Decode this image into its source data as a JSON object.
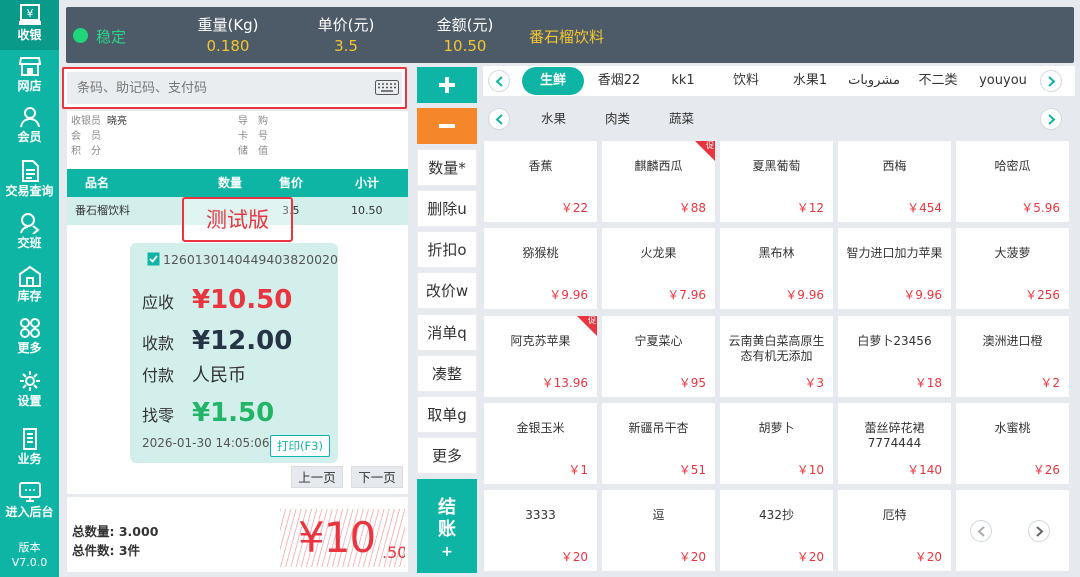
{
  "nav": {
    "items": [
      {
        "label": "收银",
        "icon": "yen-register-icon"
      },
      {
        "label": "网店",
        "icon": "store-icon"
      },
      {
        "label": "会员",
        "icon": "member-icon"
      },
      {
        "label": "交易查询",
        "icon": "transaction-doc-icon"
      },
      {
        "label": "交班",
        "icon": "shift-handover-icon"
      },
      {
        "label": "库存",
        "icon": "warehouse-icon"
      },
      {
        "label": "更多",
        "icon": "more-grid-icon"
      },
      {
        "label": "设置",
        "icon": "gear-icon"
      },
      {
        "label": "业务",
        "icon": "business-icon"
      },
      {
        "label": "进入后台",
        "icon": "backend-monitor-icon"
      }
    ],
    "version_label": "版本",
    "version": "V7.0.0"
  },
  "topbar": {
    "status": "稳定",
    "weight_label": "重量(Kg)",
    "weight": "0.180",
    "price_label": "单价(元)",
    "price": "3.5",
    "amount_label": "金额(元)",
    "amount": "10.50",
    "product": "番石榴饮料"
  },
  "search": {
    "placeholder": "条码、助记码、支付码"
  },
  "info": {
    "cashier_label": "收银员",
    "cashier": "晓亮",
    "guide_label": "导　购",
    "guide": "",
    "member_label": "会　员",
    "member": "",
    "card_label": "卡　号",
    "card": "",
    "points_label": "积　分",
    "points": "",
    "stored_label": "储　值",
    "stored": ""
  },
  "cart": {
    "headers": {
      "name": "品名",
      "qty": "数量",
      "price": "售价",
      "subtotal": "小计"
    },
    "rows": [
      {
        "name": "番石榴饮料",
        "qty": "",
        "price": "3.5",
        "subtotal": "10.50"
      }
    ]
  },
  "stamp": "测试版",
  "receipt": {
    "order_no": "1260130140449403820020",
    "due_label": "应收",
    "due": "¥10.50",
    "paid_label": "收款",
    "paid": "¥12.00",
    "method_label": "付款",
    "method": "人民币",
    "change_label": "找零",
    "change": "¥1.50",
    "datetime": "2026-01-30 14:05:06",
    "print_label": "打印(F3)"
  },
  "pager": {
    "prev": "上一页",
    "next": "下一页"
  },
  "totals": {
    "qty_label": "总数量:",
    "qty": "3.000",
    "count_label": "总件数:",
    "count": "3件",
    "amount_main": "¥10",
    "amount_cents": ".50"
  },
  "actions": {
    "buttons": [
      "数量*",
      "删除u",
      "折扣o",
      "改价w",
      "消单q",
      "凑整",
      "取单g",
      "更多"
    ],
    "checkout_line1": "结",
    "checkout_line2": "账",
    "checkout_line3": "+"
  },
  "categories": [
    "生鲜",
    "香烟22",
    "kk1",
    "饮料",
    "水果1",
    "مشروبات",
    "不二类",
    "youyou"
  ],
  "subcategories": [
    "水果",
    "肉类",
    "蔬菜"
  ],
  "promo_label": "促",
  "products": [
    {
      "name": "香蕉",
      "price": "￥22",
      "promo": false
    },
    {
      "name": "麒麟西瓜",
      "price": "￥88",
      "promo": true
    },
    {
      "name": "夏黑葡萄",
      "price": "￥12",
      "promo": false
    },
    {
      "name": "西梅",
      "price": "￥454",
      "promo": false
    },
    {
      "name": "哈密瓜",
      "price": "￥5.96",
      "promo": false
    },
    {
      "name": "猕猴桃",
      "price": "￥9.96",
      "promo": false
    },
    {
      "name": "火龙果",
      "price": "￥7.96",
      "promo": false
    },
    {
      "name": "黑布林",
      "price": "￥9.96",
      "promo": false
    },
    {
      "name": "智力进口加力苹果",
      "price": "￥9.96",
      "promo": false
    },
    {
      "name": "大菠萝",
      "price": "￥256",
      "promo": false
    },
    {
      "name": "阿克苏苹果",
      "price": "￥13.96",
      "promo": true
    },
    {
      "name": "宁夏菜心",
      "price": "￥95",
      "promo": false
    },
    {
      "name": "云南黄白菜高原生态有机无添加",
      "price": "￥3",
      "promo": false
    },
    {
      "name": "白萝卜23456",
      "price": "￥18",
      "promo": false
    },
    {
      "name": "澳洲进口橙",
      "price": "￥2",
      "promo": false
    },
    {
      "name": "金银玉米",
      "price": "￥1",
      "promo": false
    },
    {
      "name": "新疆吊干杏",
      "price": "￥51",
      "promo": false
    },
    {
      "name": "胡萝卜",
      "price": "￥10",
      "promo": false
    },
    {
      "name": "蕾丝碎花裙7774444",
      "price": "￥140",
      "promo": false
    },
    {
      "name": "水蜜桃",
      "price": "￥26",
      "promo": false
    },
    {
      "name": "3333",
      "price": "￥20",
      "promo": false
    },
    {
      "name": "逗",
      "price": "￥20",
      "promo": false
    },
    {
      "name": "432抄",
      "price": "￥20",
      "promo": false
    },
    {
      "name": "厄特",
      "price": "￥20",
      "promo": false
    }
  ],
  "colors": {
    "accent": "#0fb5a4",
    "orange": "#f5862a",
    "red": "#e8353f",
    "dark": "#4d5a67",
    "gold": "#f3c632",
    "green": "#22b565"
  }
}
